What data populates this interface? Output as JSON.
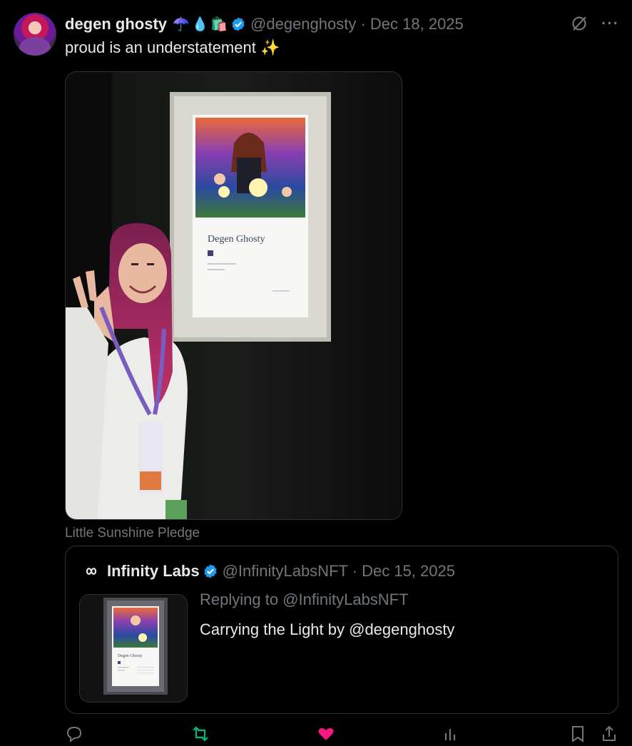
{
  "tweet": {
    "author_name": "degen ghosty",
    "author_emojis": [
      "☂️",
      "💧",
      "🛍️"
    ],
    "handle_date": "@degenghosty · Dec 18, 2025",
    "text": "proud is an understatement ✨",
    "image_caption": "Little Sunshine Pledge",
    "icons": [
      "grok-icon",
      "more-icon",
      "verified-badge-icon"
    ]
  },
  "artwork": {
    "title": "Degen Ghosty"
  },
  "quoted": {
    "author_name": "Infinity Labs",
    "handle_date": "@InfinityLabsNFT · Dec 15, 2025",
    "replying_to": "Replying to @InfinityLabsNFT",
    "text": "Carrying the Light by @degenghosty",
    "thumb_title": "Degen Ghosty"
  },
  "colors": {
    "background": "#000000",
    "text_primary": "#e7e9ea",
    "text_secondary": "#71767b",
    "border": "#2f3336",
    "verified_blue": "#1d9bf0",
    "retweet_green": "#00ba7c",
    "like_pink": "#f91880"
  }
}
